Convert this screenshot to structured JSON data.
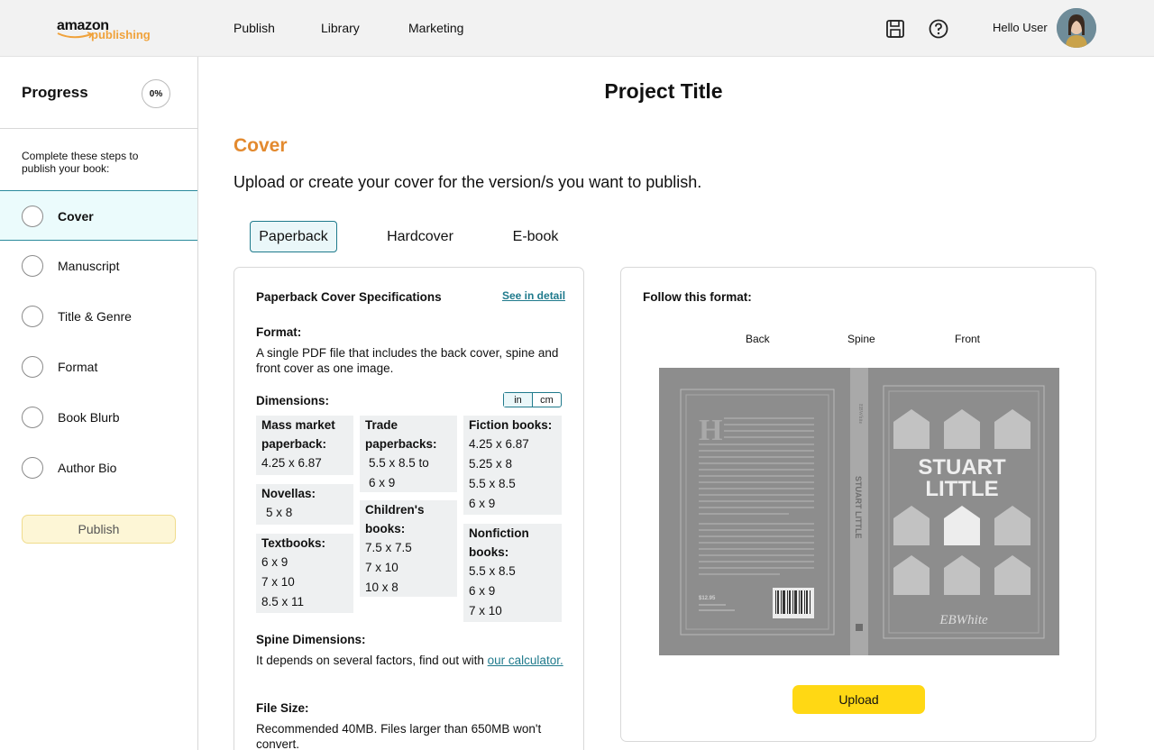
{
  "header": {
    "logo_line1": "amazon",
    "logo_line2": "publishing",
    "nav": [
      "Publish",
      "Library",
      "Marketing"
    ],
    "greeting": "Hello User",
    "icons": [
      "save-icon",
      "help-icon"
    ]
  },
  "sidebar": {
    "progress_title": "Progress",
    "progress_value": "0%",
    "intro": "Complete these steps to publish your book:",
    "steps": [
      "Cover",
      "Manuscript",
      "Title & Genre",
      "Format",
      "Book Blurb",
      "Author Bio"
    ],
    "active_step": "Cover",
    "publish_label": "Publish"
  },
  "main": {
    "project_title": "Project Title",
    "section_title": "Cover",
    "section_subtitle": "Upload or create your cover for the version/s you want to publish.",
    "tabs": [
      "Paperback",
      "Hardcover",
      "E-book"
    ],
    "active_tab": "Paperback"
  },
  "spec": {
    "title": "Paperback Cover Specifications",
    "see_detail": "See in detail",
    "format_heading": "Format:",
    "format_text": "A single PDF file that includes the back cover, spine and front cover as one image.",
    "dimensions_heading": "Dimensions:",
    "unit_in": "in",
    "unit_cm": "cm",
    "dim_mass_heading": "Mass market paperback:",
    "dim_mass_values": "4.25 x 6.87",
    "dim_novellas_heading": "Novellas:",
    "dim_novellas_values": "5 x 8",
    "dim_textbooks_heading": "Textbooks:",
    "dim_textbooks_v1": "6 x 9",
    "dim_textbooks_v2": "7 x 10",
    "dim_textbooks_v3": "8.5 x 11",
    "dim_trade_heading": "Trade paperbacks:",
    "dim_trade_v1": "5.5 x 8.5 to",
    "dim_trade_v2": "6 x 9",
    "dim_children_heading": "Children's books:",
    "dim_children_v1": "7.5 x 7.5",
    "dim_children_v2": "7 x 10",
    "dim_children_v3": "10 x 8",
    "dim_fiction_heading": "Fiction books:",
    "dim_fiction_v1": "4.25 x 6.87",
    "dim_fiction_v2": "5.25 x 8",
    "dim_fiction_v3": "5.5 x 8.5",
    "dim_fiction_v4": "6 x 9",
    "dim_nonfiction_heading": "Nonfiction books:",
    "dim_nonfiction_v1": "5.5 x 8.5",
    "dim_nonfiction_v2": "6 x 9",
    "dim_nonfiction_v3": "7 x 10",
    "spine_heading": "Spine Dimensions:",
    "spine_text": "It depends on several factors, find out with ",
    "spine_link": "our calculator.",
    "filesize_heading": "File Size:",
    "filesize_text": "Recommended 40MB. Files larger than 650MB won't convert."
  },
  "format": {
    "title": "Follow this format:",
    "label_back": "Back",
    "label_spine": "Spine",
    "label_front": "Front",
    "cover_title_line1": "STUART",
    "cover_title_line2": "LITTLE",
    "cover_author": "EBWhite",
    "spine_title": "STUART LITTLE",
    "back_price": "$12.95",
    "upload_label": "Upload"
  },
  "colors": {
    "accent_orange": "#e38a2f",
    "teal": "#1f7a8c",
    "upload_yellow": "#ffd814"
  }
}
